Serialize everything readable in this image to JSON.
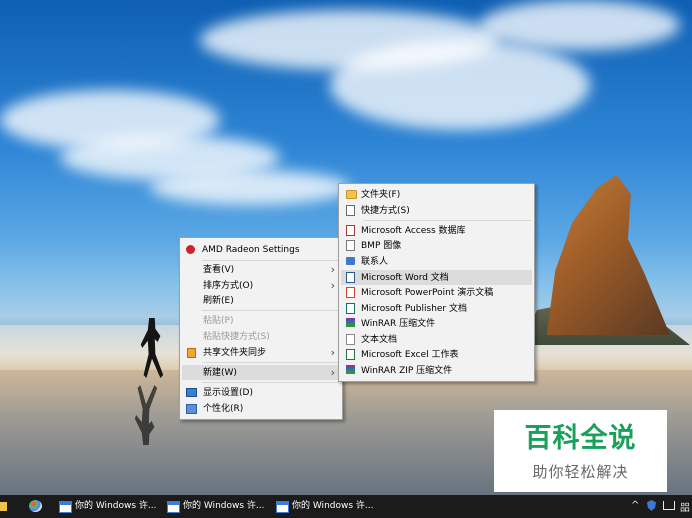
{
  "context_menu": {
    "items": [
      {
        "label": "AMD Radeon Settings",
        "icon": "amd-radeon-icon"
      },
      {
        "label": "查看(V)",
        "submenu": true
      },
      {
        "label": "排序方式(O)",
        "submenu": true
      },
      {
        "label": "刷新(E)"
      },
      {
        "label": "粘贴(P)",
        "disabled": true
      },
      {
        "label": "粘贴快捷方式(S)",
        "disabled": true
      },
      {
        "label": "共享文件夹同步",
        "icon": "share-sync-icon",
        "submenu": true
      },
      {
        "label": "新建(W)",
        "submenu": true,
        "highlighted": true
      },
      {
        "label": "显示设置(D)",
        "icon": "display-settings-icon"
      },
      {
        "label": "个性化(R)",
        "icon": "personalize-icon"
      }
    ],
    "arrow": "›"
  },
  "new_submenu": {
    "items": [
      {
        "label": "文件夹(F)",
        "icon": "folder-icon"
      },
      {
        "label": "快捷方式(S)",
        "icon": "shortcut-icon"
      },
      {
        "label": "Microsoft Access 数据库",
        "icon": "access-icon"
      },
      {
        "label": "BMP 图像",
        "icon": "bmp-icon"
      },
      {
        "label": "联系人",
        "icon": "contact-icon"
      },
      {
        "label": "Microsoft Word 文档",
        "icon": "word-icon",
        "highlighted": true
      },
      {
        "label": "Microsoft PowerPoint 演示文稿",
        "icon": "powerpoint-icon"
      },
      {
        "label": "Microsoft Publisher 文档",
        "icon": "publisher-icon"
      },
      {
        "label": "WinRAR 压缩文件",
        "icon": "winrar-icon"
      },
      {
        "label": "文本文档",
        "icon": "text-document-icon"
      },
      {
        "label": "Microsoft Excel 工作表",
        "icon": "excel-icon"
      },
      {
        "label": "WinRAR ZIP 压缩文件",
        "icon": "winrar-zip-icon"
      }
    ]
  },
  "watermark": {
    "title": "百科全说",
    "subtitle": "助你轻松解决",
    "color": "#19a05b"
  },
  "taskbar": {
    "tasks": [
      {
        "label": "你的 Windows 许..."
      },
      {
        "label": "你的 Windows 许..."
      },
      {
        "label": "你的 Windows 许..."
      }
    ],
    "tray": {
      "chevron": "^",
      "ime": "㗊"
    }
  }
}
